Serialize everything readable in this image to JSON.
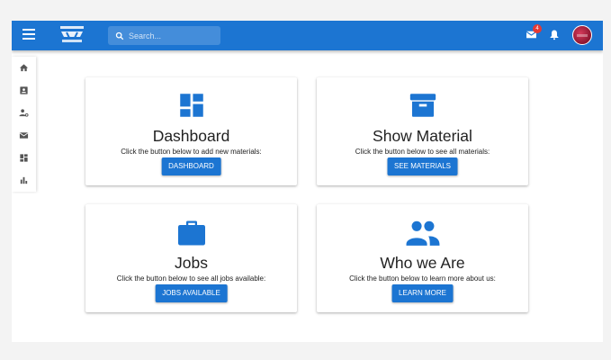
{
  "header": {
    "search_placeholder": "Search...",
    "mail_count": "4",
    "accent_color": "#1c75d2",
    "badge_color": "#e53935"
  },
  "sidebar": {
    "items": [
      {
        "icon": "home-icon"
      },
      {
        "icon": "contact-card-icon"
      },
      {
        "icon": "user-settings-icon"
      },
      {
        "icon": "mail-icon"
      },
      {
        "icon": "dashboard-icon"
      },
      {
        "icon": "bar-chart-icon"
      }
    ]
  },
  "cards": [
    {
      "title": "Dashboard",
      "text": "Click the button below to add new materials:",
      "button": "DASHBOARD",
      "icon": "dashboard-icon"
    },
    {
      "title": "Show Material",
      "text": "Click the button below to see all materials:",
      "button": "SEE MATERIALS",
      "icon": "archive-box-icon"
    },
    {
      "title": "Jobs",
      "text": "Click the button below to see all jobs available:",
      "button": "JOBS AVAILABLE",
      "icon": "briefcase-icon"
    },
    {
      "title": "Who we Are",
      "text": "Click the button below to learn more about us:",
      "button": "LEARN MORE",
      "icon": "people-icon"
    }
  ]
}
